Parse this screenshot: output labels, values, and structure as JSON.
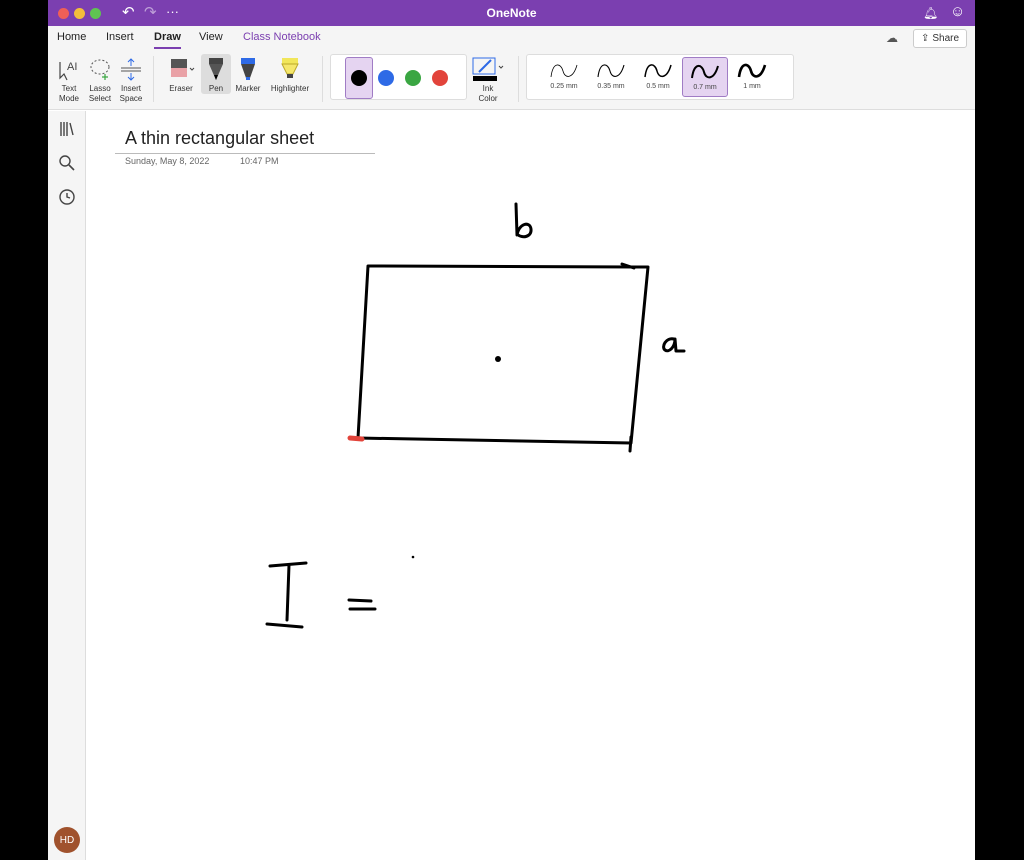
{
  "window": {
    "title": "OneNote"
  },
  "tabs": [
    {
      "label": "Home"
    },
    {
      "label": "Insert"
    },
    {
      "label": "Draw"
    },
    {
      "label": "View"
    },
    {
      "label": "Class Notebook"
    }
  ],
  "share": {
    "label": "Share"
  },
  "ribbon": {
    "text_mode": {
      "line1": "Text",
      "line2": "Mode"
    },
    "lasso": {
      "line1": "Lasso",
      "line2": "Select"
    },
    "insert_space": {
      "line1": "Insert",
      "line2": "Space"
    },
    "eraser": "Eraser",
    "pen": "Pen",
    "marker": "Marker",
    "highlighter": "Highlighter",
    "ink_color": {
      "line1": "Ink",
      "line2": "Color"
    },
    "colors": [
      "#000000",
      "#2e6ae6",
      "#3aa642",
      "#e2443b"
    ],
    "pen_sizes": [
      "0.25 mm",
      "0.35 mm",
      "0.5 mm",
      "0.7 mm",
      "1 mm"
    ]
  },
  "page": {
    "title": "A thin rectangular sheet",
    "date": "Sunday, May 8, 2022",
    "time": "10:47 PM"
  },
  "user": {
    "initials": "HD"
  },
  "accent_color": "#7b3fb0"
}
